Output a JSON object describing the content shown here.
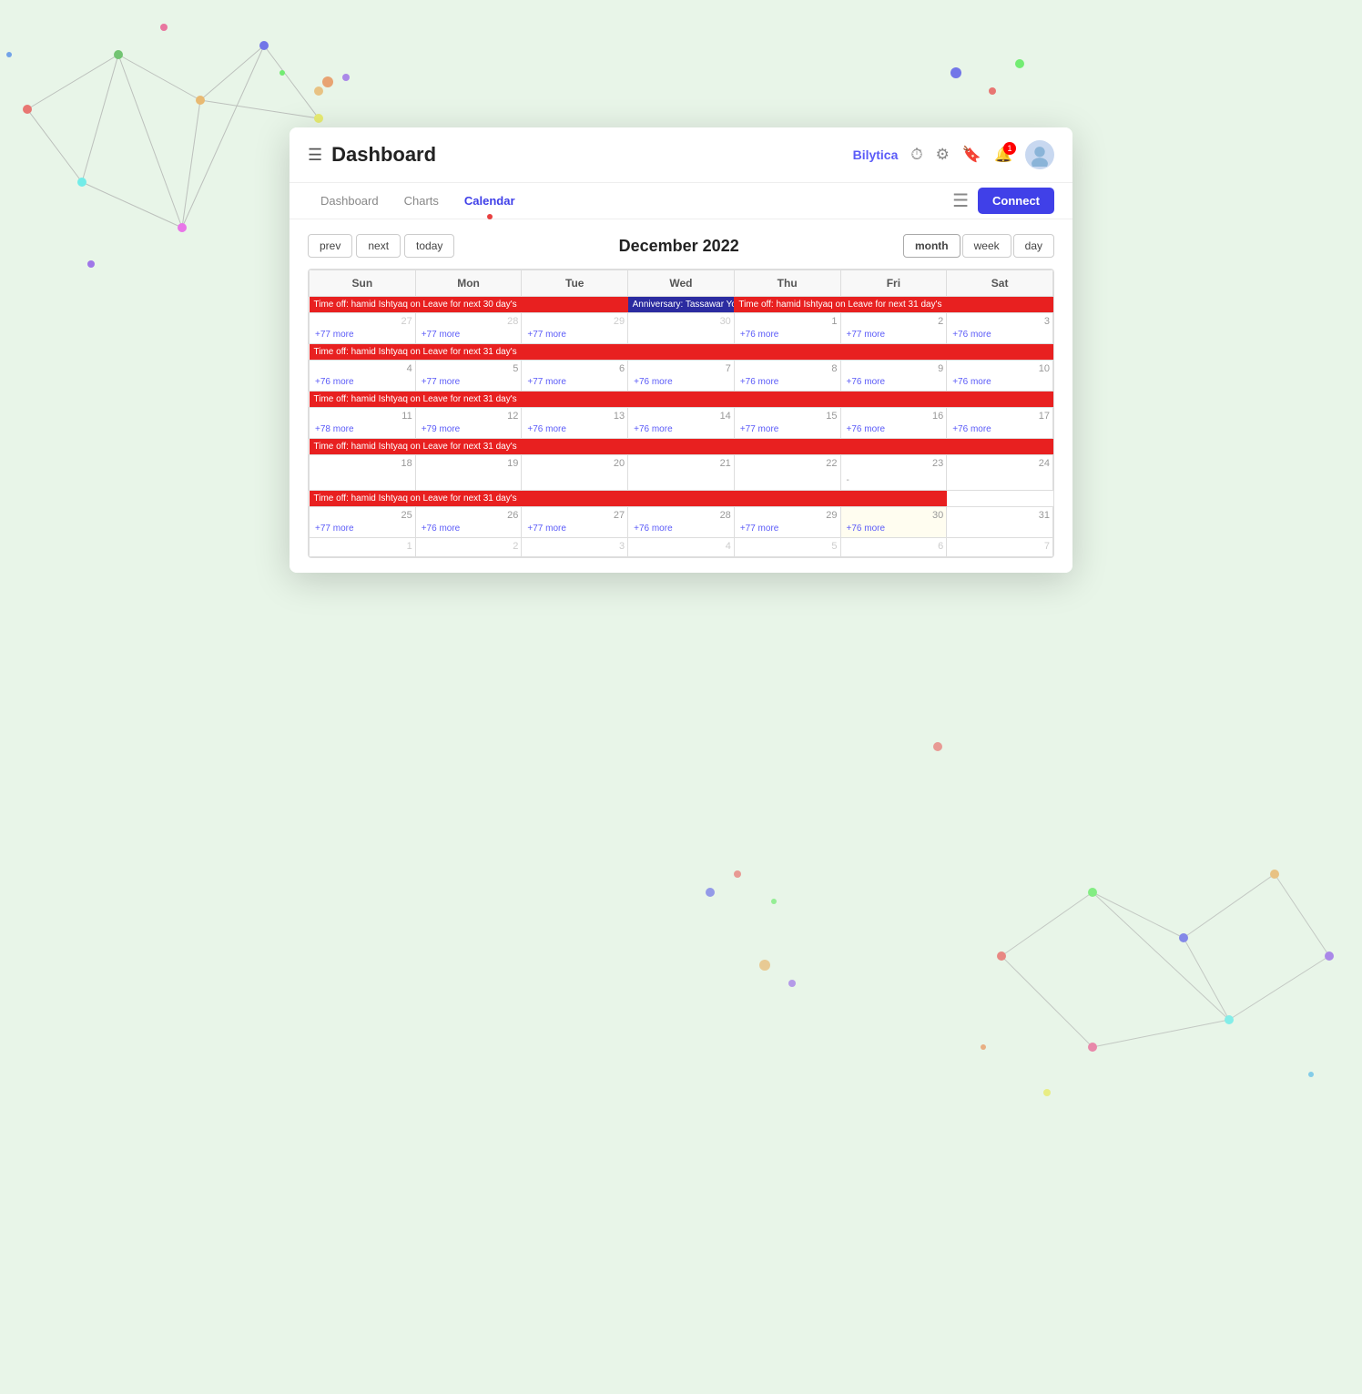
{
  "header": {
    "menu_icon": "☰",
    "title": "Dashboard",
    "brand": "Bilytica",
    "icons": [
      "clock",
      "gear",
      "bookmark",
      "bell",
      "avatar"
    ],
    "notif_count": "1",
    "connect_label": "Connect"
  },
  "nav": {
    "tabs": [
      {
        "label": "Dashboard",
        "active": false
      },
      {
        "label": "Charts",
        "active": false
      },
      {
        "label": "Calendar",
        "active": true
      }
    ]
  },
  "calendar": {
    "title": "December 2022",
    "prev_label": "prev",
    "next_label": "next",
    "today_label": "today",
    "view_month": "month",
    "view_week": "week",
    "view_day": "day",
    "days": [
      "Sun",
      "Mon",
      "Tue",
      "Wed",
      "Thu",
      "Fri",
      "Sat"
    ],
    "weeks": [
      {
        "numbers": [
          "27",
          "28",
          "29",
          "30",
          "1",
          "2",
          "3"
        ],
        "dim": [
          true,
          true,
          true,
          true,
          false,
          false,
          false
        ],
        "event_red": "Time off: hamid Ishtyaq on Leave for next 30 day's",
        "event_red_span": "0-2",
        "event_blue": "Anniversary: Tassawar You",
        "event_blue_col": 3,
        "event_red2": "Time off: hamid Ishtyaq on Leave for next 31 day's",
        "event_red2_span": "4-6",
        "more": [
          "+77 more",
          "+77 more",
          "+77 more",
          "",
          "+76 more",
          "+77 more",
          "+76 more"
        ]
      },
      {
        "numbers": [
          "4",
          "5",
          "6",
          "7",
          "8",
          "9",
          "10"
        ],
        "dim": [
          false,
          false,
          false,
          false,
          false,
          false,
          false
        ],
        "event_red": "Time off: hamid Ishtyaq on Leave for next 31 day's",
        "event_red_span": "0-6",
        "more": [
          "+76 more",
          "+77 more",
          "+77 more",
          "+76 more",
          "+76 more",
          "+76 more",
          "+76 more"
        ]
      },
      {
        "numbers": [
          "11",
          "12",
          "13",
          "14",
          "15",
          "16",
          "17"
        ],
        "dim": [
          false,
          false,
          false,
          false,
          false,
          false,
          false
        ],
        "event_red": "Time off: hamid Ishtyaq on Leave for next 31 day's",
        "event_red_span": "0-6",
        "more": [
          "+78 more",
          "+79 more",
          "+76 more",
          "+76 more",
          "+77 more",
          "+76 more",
          "+76 more"
        ]
      },
      {
        "numbers": [
          "18",
          "19",
          "20",
          "21",
          "22",
          "23",
          "24"
        ],
        "dim": [
          false,
          false,
          false,
          false,
          false,
          false,
          false
        ],
        "event_red": "Time off: hamid Ishtyaq on Leave for next 31 day's",
        "event_red_span": "0-6",
        "more": [
          "",
          "",
          "",
          "",
          "",
          "-",
          ""
        ]
      },
      {
        "numbers": [
          "25",
          "26",
          "27",
          "28",
          "29",
          "30",
          "31"
        ],
        "dim": [
          false,
          false,
          false,
          false,
          false,
          false,
          false
        ],
        "event_red": "Time off: hamid Ishtyaq on Leave for next 31 day's",
        "event_red_span": "0-4",
        "today_col": 5,
        "more": [
          "+77 more",
          "+76 more",
          "+77 more",
          "+76 more",
          "+77 more",
          "+76 more",
          ""
        ]
      },
      {
        "numbers": [
          "1",
          "2",
          "3",
          "4",
          "5",
          "6",
          "7"
        ],
        "dim": [
          true,
          true,
          true,
          true,
          true,
          true,
          true
        ],
        "more": [
          "",
          "",
          "",
          "",
          "",
          "",
          ""
        ]
      }
    ]
  }
}
